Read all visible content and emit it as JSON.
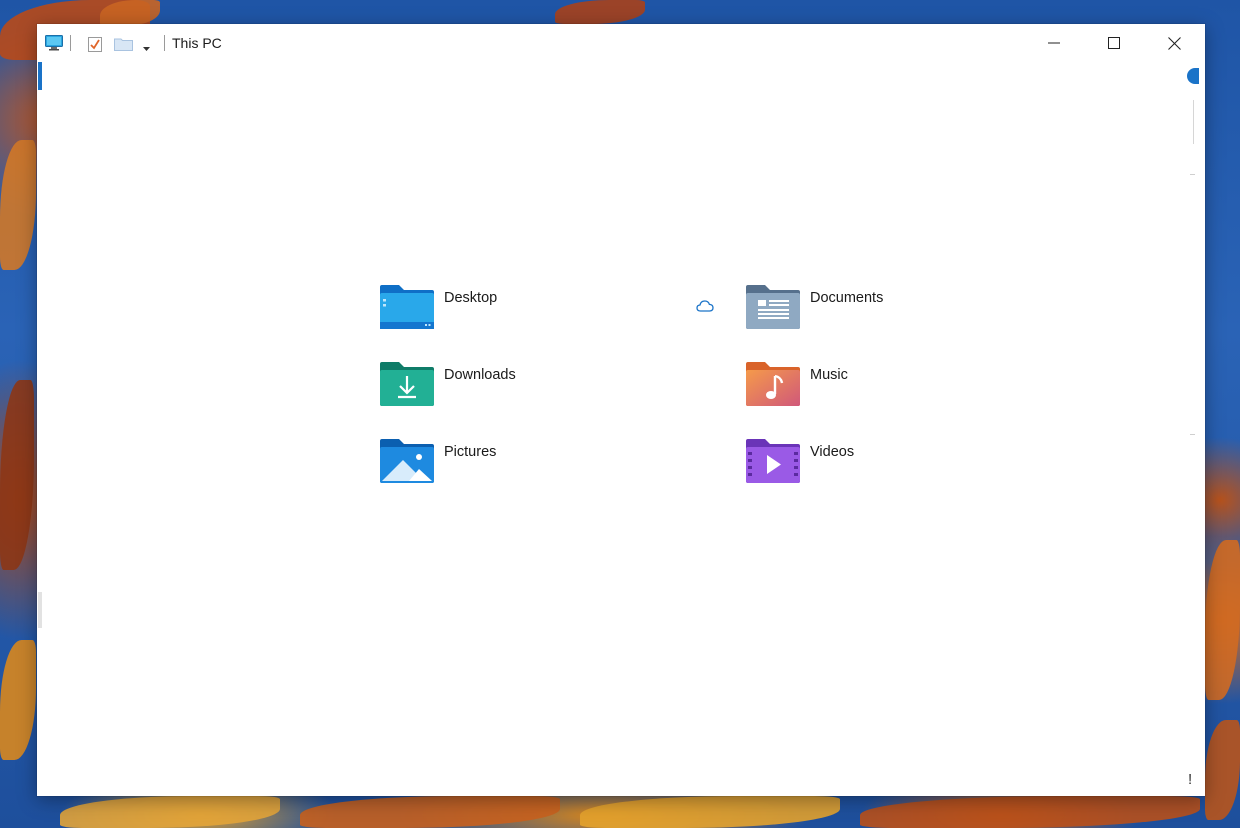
{
  "window": {
    "title": "This PC"
  },
  "titlebar": {
    "icons": [
      "computer-icon",
      "properties-check-icon",
      "new-folder-icon",
      "chevron-down-icon"
    ],
    "minimize": "minimize-icon",
    "maximize": "maximize-icon",
    "close": "close-icon"
  },
  "folders": [
    {
      "name": "Desktop",
      "icon": "desktop-folder-icon",
      "color": "#1e88e5"
    },
    {
      "name": "Documents",
      "icon": "documents-folder-icon",
      "color": "#6d8fae",
      "status": "cloud-icon"
    },
    {
      "name": "Downloads",
      "icon": "downloads-folder-icon",
      "color": "#1fa58d"
    },
    {
      "name": "Music",
      "icon": "music-folder-icon",
      "color": "#e8734a"
    },
    {
      "name": "Pictures",
      "icon": "pictures-folder-icon",
      "color": "#1a7ed6"
    },
    {
      "name": "Videos",
      "icon": "videos-folder-icon",
      "color": "#8b4fd6"
    }
  ],
  "footer": {
    "mark": "!"
  },
  "colors": {
    "accent": "#1a73c8",
    "window_bg": "#ffffff"
  }
}
